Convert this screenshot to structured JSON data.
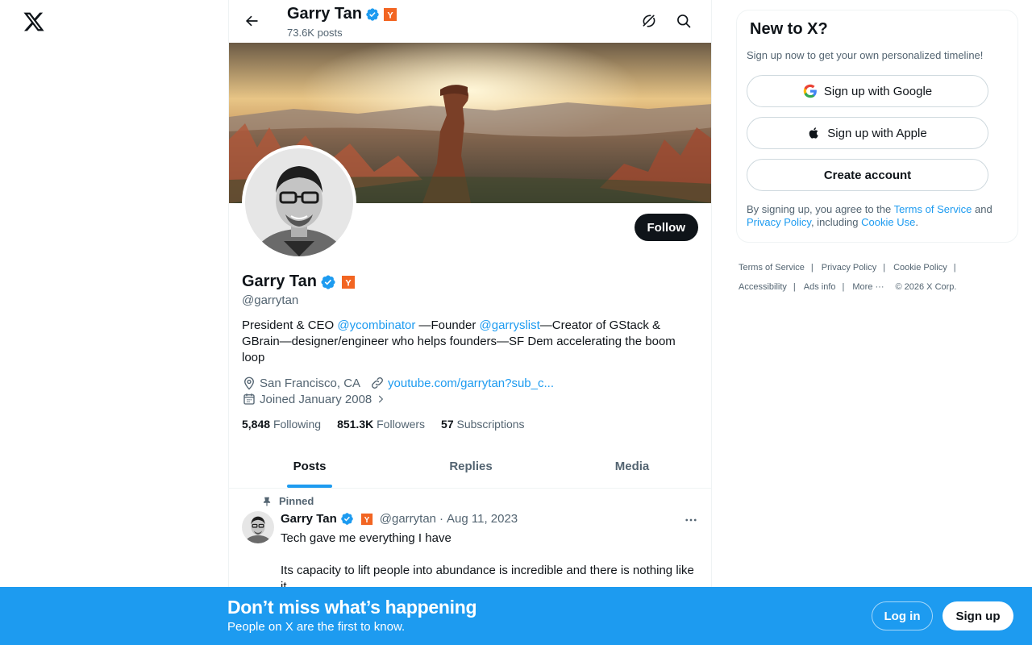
{
  "header": {
    "name": "Garry Tan",
    "post_count": "73.6K posts"
  },
  "profile": {
    "name": "Garry Tan",
    "handle": "@garrytan",
    "bio": {
      "part1": "President & CEO ",
      "mention1": "@ycombinator",
      "part2": " —Founder ",
      "mention2": "@garryslist",
      "part3": "—Creator of GStack & GBrain—designer/engineer who helps founders—SF Dem accelerating the boom loop"
    },
    "location": "San Francisco, CA",
    "website": "youtube.com/garrytan?sub_c...",
    "joined": "Joined January 2008",
    "follow_label": "Follow",
    "verified_color": "#1d9bf0",
    "affiliate_badge_color": "#f26522"
  },
  "stats": {
    "following_count": "5,848",
    "following_label": "Following",
    "followers_count": "851.3K",
    "followers_label": "Followers",
    "subscriptions_count": "57",
    "subscriptions_label": "Subscriptions"
  },
  "tabs": [
    {
      "label": "Posts",
      "active": true
    },
    {
      "label": "Replies",
      "active": false
    },
    {
      "label": "Media",
      "active": false
    }
  ],
  "pinned_post": {
    "pinned_label": "Pinned",
    "author_name": "Garry Tan",
    "author_handle": "@garrytan",
    "separator": "·",
    "date": "Aug 11, 2023",
    "text": "Tech gave me everything I have\n\nIts capacity to lift people into abundance is incredible and there is nothing like it"
  },
  "signup_card": {
    "title": "New to X?",
    "subtitle": "Sign up now to get your own personalized timeline!",
    "google_label": "Sign up with Google",
    "apple_label": "Sign up with Apple",
    "create_label": "Create account",
    "legal_prefix": "By signing up, you agree to the ",
    "terms_link": "Terms of Service",
    "legal_and": " and ",
    "privacy_link": "Privacy Policy",
    "legal_including": ", including ",
    "cookie_link": "Cookie Use",
    "legal_suffix": "."
  },
  "footer": {
    "terms": "Terms of Service",
    "privacy": "Privacy Policy",
    "cookie": "Cookie Policy",
    "accessibility": "Accessibility",
    "ads": "Ads info",
    "more": "More ···",
    "copyright": "© 2026 X Corp.",
    "divider": "|"
  },
  "bottom_bar": {
    "title": "Don’t miss what’s happening",
    "subtitle": "People on X are the first to know.",
    "login_label": "Log in",
    "signup_label": "Sign up"
  },
  "icons": {
    "logo": "x-logo-icon",
    "back": "arrow-left-icon",
    "grok": "grok-icon",
    "search": "search-icon",
    "verified": "verified-badge-icon",
    "affiliate": "y-combinator-badge-icon",
    "location": "location-pin-icon",
    "link": "link-icon",
    "calendar": "calendar-icon",
    "pin": "pin-icon",
    "more": "more-dots-icon",
    "google": "google-icon",
    "apple": "apple-icon"
  }
}
